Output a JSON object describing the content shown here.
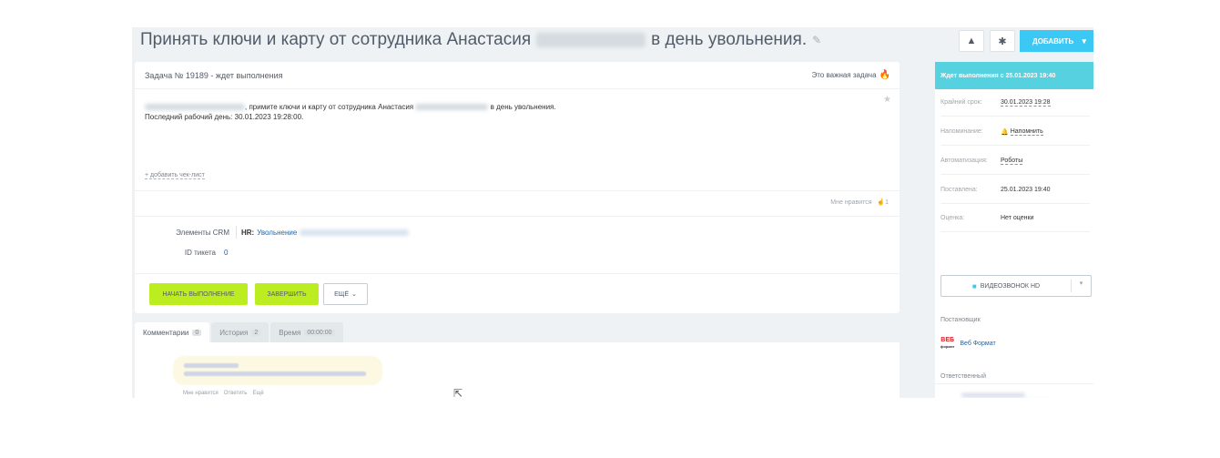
{
  "header": {
    "title_prefix": "Принять ключи и карту от сотрудника Анастасия",
    "title_suffix": "в день увольнения.",
    "add_button": "ДОБАВИТЬ"
  },
  "task": {
    "number_status": "Задача № 19189 - ждет выполнения",
    "important": "Это важная задача",
    "desc_line1_suffix": ", примите ключи и карту от сотрудника Анастасия",
    "desc_line1_end": "в день увольнения.",
    "desc_line2": "Последний рабочий день: 30.01.2023 19:28:00.",
    "checklist": "+ добавить чек-лист",
    "likes": "Мне нравится",
    "likes_count": "1",
    "crm_label": "Элементы CRM",
    "crm_prefix": "HR:",
    "crm_value": "Увольнение",
    "ticket_label": "ID тикета",
    "ticket_value": "0",
    "start_button": "НАЧАТЬ ВЫПОЛНЕНИЕ",
    "finish_button": "ЗАВЕРШИТЬ",
    "more_button": "ЕЩЁ"
  },
  "tabs": [
    {
      "label": "Комментарии",
      "count": "0"
    },
    {
      "label": "История",
      "count": "2"
    },
    {
      "label": "Время",
      "count": "00:00:00"
    }
  ],
  "comment_actions": [
    "Мне нравится",
    "Ответить",
    "Ещё"
  ],
  "sidebar": {
    "status": "Ждет выполнения с 25.01.2023 19:40",
    "deadline_label": "Крайний срок:",
    "deadline_value": "30.01.2023 19:28",
    "reminder_label": "Напоминание:",
    "reminder_value": "Напомнить",
    "automation_label": "Автоматизация:",
    "automation_value": "Роботы",
    "created_label": "Поставлена:",
    "created_value": "25.01.2023 19:40",
    "rating_label": "Оценка:",
    "rating_value": "Нет оценки",
    "video_button": "ВИДЕОЗВОНОК HD",
    "creator_label": "Постановщик",
    "creator_logo": "ВЕБ",
    "creator_name": "Веб Формат",
    "responsible_label": "Ответственный",
    "responsible_tail": "пр"
  }
}
